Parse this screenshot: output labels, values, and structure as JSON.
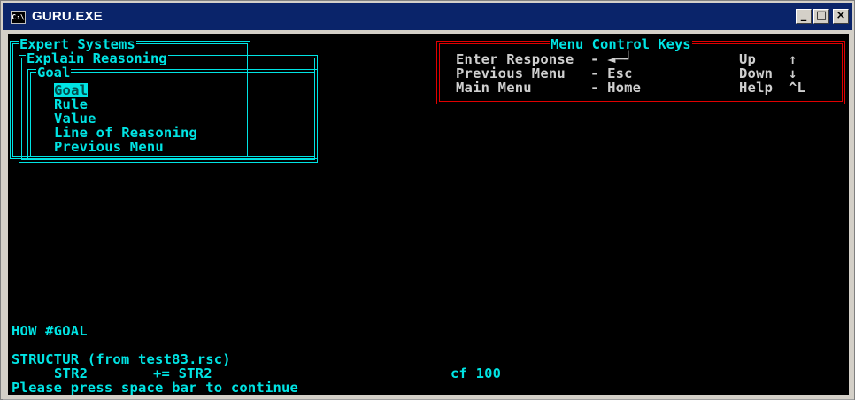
{
  "window": {
    "title": "GURU.EXE",
    "icon_label": "C:\\",
    "buttons": {
      "minimize": "_",
      "maximize": "□",
      "close": "×"
    }
  },
  "menus": {
    "expert_systems": {
      "title": "Expert Systems"
    },
    "explain_reasoning": {
      "title": "Explain Reasoning"
    },
    "goal": {
      "title": "Goal",
      "items": [
        "Goal",
        "Rule",
        "Value",
        "Line of Reasoning",
        "Previous Menu"
      ],
      "selected_index": 0
    }
  },
  "control_keys": {
    "title": "Menu Control Keys",
    "rows": [
      {
        "action": "Enter Response",
        "key": "- ◄─┘",
        "nav": "Up",
        "arrow": "↑"
      },
      {
        "action": "Previous Menu",
        "key": "- Esc",
        "nav": "Down",
        "arrow": "↓"
      },
      {
        "action": "Main Menu",
        "key": "- Home",
        "nav": "Help",
        "arrow": "^L"
      }
    ]
  },
  "output": {
    "command": "HOW #GOAL",
    "line1": "STRUCTUR (from test83.rsc)",
    "line2_var": "STR2",
    "line2_expr": "+= STR2",
    "line2_cf": "cf 100",
    "prompt": "Please press space bar to continue"
  },
  "colors": {
    "cyan": "#00e4e4",
    "red": "#e00000",
    "titlebar": "#0a246a",
    "console_bg": "#000000"
  }
}
